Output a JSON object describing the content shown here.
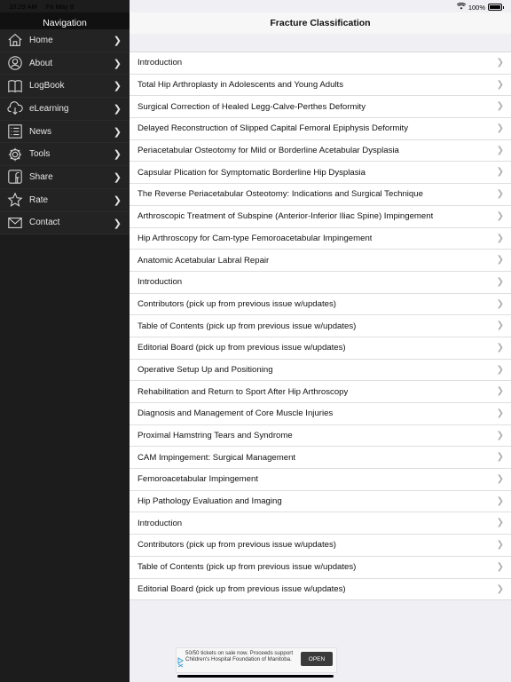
{
  "status_bar": {
    "time": "10:29 AM",
    "date": "Fri May 8",
    "battery": "100%"
  },
  "sidebar": {
    "title": "Navigation",
    "items": [
      {
        "label": "Home",
        "icon": "home-icon"
      },
      {
        "label": "About",
        "icon": "about-icon"
      },
      {
        "label": "LogBook",
        "icon": "book-icon"
      },
      {
        "label": "eLearning",
        "icon": "cloud-download-icon"
      },
      {
        "label": "News",
        "icon": "list-icon"
      },
      {
        "label": "Tools",
        "icon": "gear-icon"
      },
      {
        "label": "Share",
        "icon": "facebook-icon"
      },
      {
        "label": "Rate",
        "icon": "star-icon"
      },
      {
        "label": "Contact",
        "icon": "envelope-icon"
      }
    ]
  },
  "main": {
    "title": "Fracture Classification",
    "rows": [
      "Introduction",
      "Total Hip Arthroplasty in Adolescents and Young Adults",
      "Surgical Correction of Healed Legg-Calve-Perthes Deformity",
      "Delayed Reconstruction of Slipped Capital Femoral Epiphysis Deformity",
      "Periacetabular Osteotomy for Mild or Borderline Acetabular Dysplasia",
      "Capsular Plication for Symptomatic Borderline Hip Dysplasia",
      "The Reverse Periacetabular Osteotomy: Indications and Surgical Technique",
      "Arthroscopic Treatment of Subspine (Anterior-Inferior Iliac Spine) Impingement",
      "Hip Arthroscopy for Cam-type Femoroacetabular Impingement",
      "Anatomic Acetabular Labral Repair",
      "Introduction",
      "Contributors (pick up from previous issue w/updates)",
      "Table of Contents (pick up from previous issue w/updates)",
      "Editorial Board (pick up from previous issue w/updates)",
      "Operative Setup Up and Positioning",
      "Rehabilitation and Return to Sport After Hip Arthroscopy",
      "Diagnosis and Management of Core Muscle Injuries",
      "Proximal Hamstring Tears and Syndrome",
      "CAM Impingement: Surgical Management",
      "Femoroacetabular Impingement",
      "Hip Pathology Evaluation and Imaging",
      "Introduction",
      "Contributors (pick up from previous issue w/updates)",
      "Table of Contents (pick up from previous issue w/updates)",
      "Editorial Board (pick up from previous issue w/updates)"
    ]
  },
  "ad": {
    "text": "50/50 tickets on sale now. Proceeds support Children's Hospital Foundation of Manitoba.",
    "button": "OPEN"
  },
  "colors": {
    "sidebar_bg": "#232323",
    "header_bg": "#111111",
    "list_bg": "#ffffff",
    "chevron": "#b0b0b5"
  }
}
